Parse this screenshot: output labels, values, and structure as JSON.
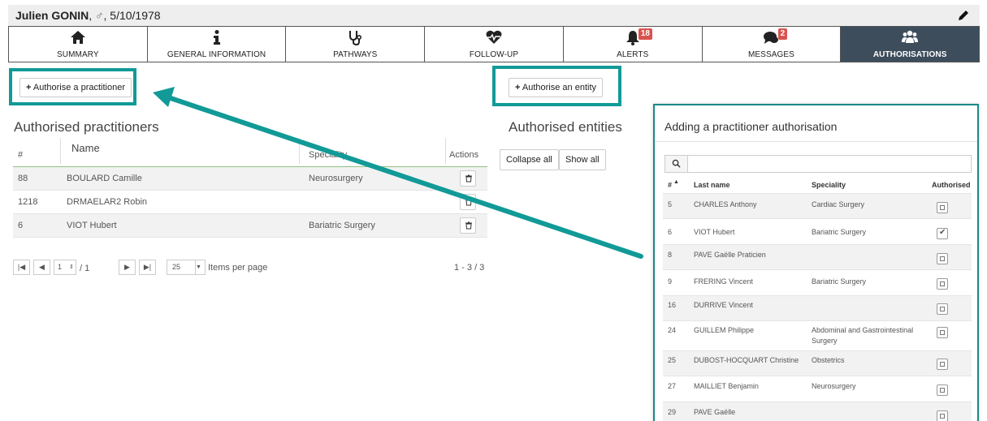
{
  "patient": {
    "name": "Julien GONIN",
    "gender_symbol": "♂",
    "dob": "5/10/1978",
    "separator": ","
  },
  "tabs": [
    {
      "label": "SUMMARY",
      "icon": "home-icon"
    },
    {
      "label": "GENERAL INFORMATION",
      "icon": "info-icon"
    },
    {
      "label": "PATHWAYS",
      "icon": "stethoscope-icon"
    },
    {
      "label": "FOLLOW-UP",
      "icon": "heartbeat-icon"
    },
    {
      "label": "ALERTS",
      "icon": "bell-icon",
      "badge": "18"
    },
    {
      "label": "MESSAGES",
      "icon": "comments-icon",
      "badge": "2"
    },
    {
      "label": "AUTHORISATIONS",
      "icon": "users-icon",
      "active": true
    }
  ],
  "buttons": {
    "authorise_practitioner": "Authorise a practitioner",
    "authorise_entity": "Authorise an entity",
    "collapse_all": "Collapse all",
    "show_all": "Show all"
  },
  "practitioners": {
    "title": "Authorised practitioners",
    "columns": {
      "num": "#",
      "name": "Name",
      "speciality": "Speciality",
      "actions": "Actions"
    },
    "rows": [
      {
        "id": "88",
        "name": "BOULARD Camille",
        "speciality": "Neurosurgery"
      },
      {
        "id": "1218",
        "name": "DRMAELAR2 Robin",
        "speciality": ""
      },
      {
        "id": "6",
        "name": "VIOT Hubert",
        "speciality": "Bariatric Surgery"
      }
    ]
  },
  "entities": {
    "title": "Authorised entities"
  },
  "pager": {
    "page": "1",
    "of": "/ 1",
    "per_page": "25",
    "per_page_label": "Items per page",
    "range": "1 - 3 / 3"
  },
  "panel": {
    "title": "Adding a practitioner authorisation",
    "search_placeholder": "",
    "columns": {
      "num": "#",
      "last_name": "Last name",
      "speciality": "Speciality",
      "authorised": "Authorised"
    },
    "rows": [
      {
        "id": "5",
        "name": "CHARLES Anthony",
        "speciality": "Cardiac Surgery",
        "authorised": false
      },
      {
        "id": "6",
        "name": "VIOT Hubert",
        "speciality": "Bariatric Surgery",
        "authorised": true
      },
      {
        "id": "8",
        "name": "PAVE Gaëlle Praticien",
        "speciality": "",
        "authorised": false
      },
      {
        "id": "9",
        "name": "FRERING Vincent",
        "speciality": "Bariatric Surgery",
        "authorised": false
      },
      {
        "id": "16",
        "name": "DURRIVE Vincent",
        "speciality": "",
        "authorised": false
      },
      {
        "id": "24",
        "name": "GUILLEM Philippe",
        "speciality": "Abdominal and Gastrointestinal Surgery",
        "authorised": false
      },
      {
        "id": "25",
        "name": "DUBOST-HOCQUART Christine",
        "speciality": "Obstetrics",
        "authorised": false
      },
      {
        "id": "27",
        "name": "MAILLIET Benjamin",
        "speciality": "Neurosurgery",
        "authorised": false
      },
      {
        "id": "29",
        "name": "PAVE Gaëlle",
        "speciality": "",
        "authorised": false
      }
    ]
  },
  "colors": {
    "highlight": "#119a97",
    "active_tab": "#3d4d5c",
    "badge": "#d9534f",
    "table_header_border": "#8fbf80"
  }
}
